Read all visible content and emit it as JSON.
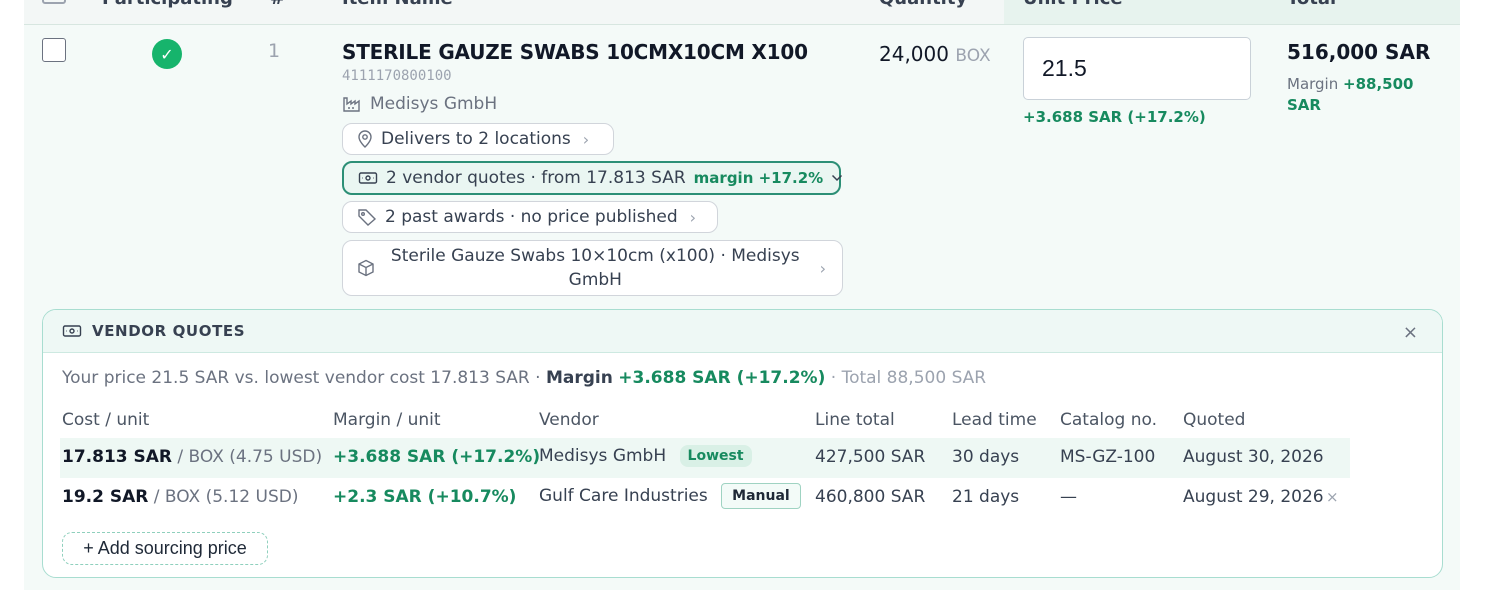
{
  "header": {
    "participating": "Participating",
    "num": "#",
    "item_name": "Item Name",
    "quantity": "Quantity",
    "unit_price": "Unit Price",
    "total": "Total"
  },
  "row": {
    "number": "1",
    "participating_mark": "✓",
    "title": "STERILE GAUZE SWABS 10CMX10CM X100",
    "code": "4111170800100",
    "vendor": "Medisys GmbH",
    "deliver_chip": "Delivers to 2 locations",
    "quotes_chip": "2 vendor quotes · from 17.813 SAR",
    "quotes_margin": "margin +17.2%",
    "awards_chip": "2 past awards · no price published",
    "product_chip": "Sterile Gauze Swabs 10×10cm (x100) · Medisys GmbH",
    "quantity": "24,000",
    "quantity_unit": "BOX",
    "unit_price_value": "21.5",
    "unit_price_margin": "+3.688 SAR (+17.2%)",
    "total": "516,000 SAR",
    "total_margin_label": "Margin",
    "total_margin_value": "+88,500 SAR"
  },
  "panel": {
    "title": "VENDOR QUOTES",
    "close": "×",
    "summary": {
      "lead": "Your price 21.5 SAR vs. lowest vendor cost 17.813 SAR ·",
      "margin_label": "Margin",
      "margin_value": "+3.688 SAR (+17.2%)",
      "total": "· Total 88,500 SAR"
    },
    "columns": {
      "cost": "Cost / unit",
      "margin": "Margin / unit",
      "vendor": "Vendor",
      "line_total": "Line total",
      "lead_time": "Lead time",
      "catalog": "Catalog no.",
      "quoted": "Quoted"
    },
    "quotes": [
      {
        "cost": "17.813 SAR",
        "unit": "/ BOX",
        "usd": "(4.75 USD)",
        "margin": "+3.688 SAR (+17.2%)",
        "vendor": "Medisys GmbH",
        "badge": "Lowest",
        "line_total": "427,500 SAR",
        "lead_time": "30 days",
        "catalog": "MS-GZ-100",
        "quoted": "August 30, 2026"
      },
      {
        "cost": "19.2 SAR",
        "unit": "/ BOX",
        "usd": "(5.12 USD)",
        "margin": "+2.3 SAR (+10.7%)",
        "vendor": "Gulf Care Industries",
        "badge": "Manual",
        "line_total": "460,800 SAR",
        "lead_time": "21 days",
        "catalog": "—",
        "quoted": "August 29, 2026",
        "remove": "×"
      }
    ],
    "add_button": "+ Add sourcing price"
  },
  "colors": {
    "accent_green": "#178a5f",
    "badge_green": "#16b46c",
    "panel_border": "#a8ddd0"
  }
}
